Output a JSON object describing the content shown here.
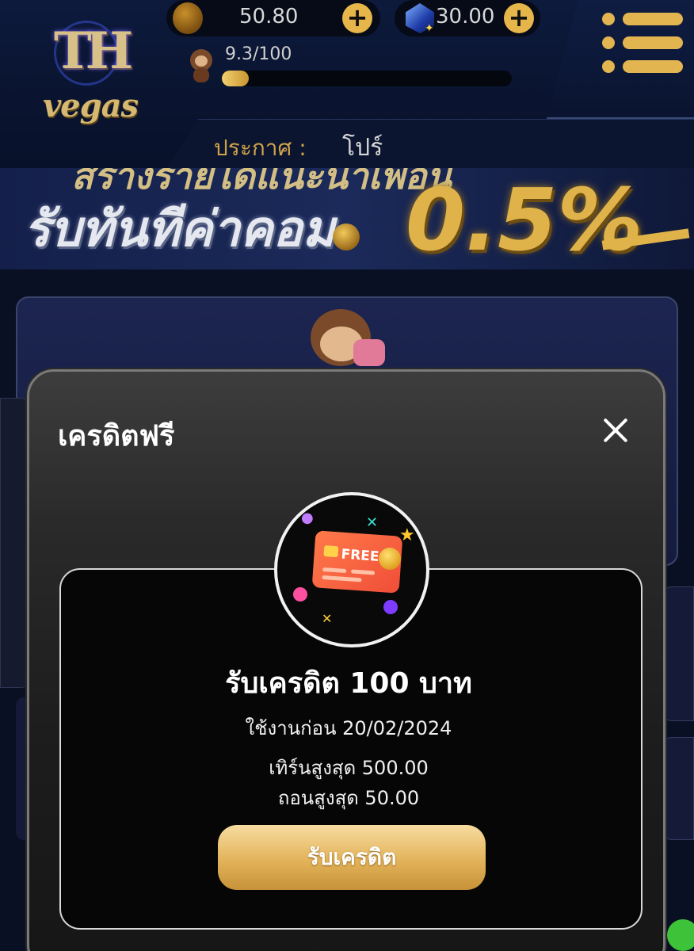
{
  "header": {
    "logo_top": "TH",
    "logo_bottom": "vegas",
    "coin_balance": "50.80",
    "gem_balance": "30.00",
    "plus_label": "+",
    "xp_text": "9.3/100",
    "xp_progress_fraction": 0.093,
    "announce_label": "ประกาศ :",
    "announce_text": "โปร์"
  },
  "banner": {
    "line_main": "รับทันทีค่าคอม",
    "percent": "0.5%"
  },
  "modal": {
    "title": "เครดิตฟรี",
    "card_label": "FREE",
    "reward_title": "รับเครดิต 100 บาท",
    "expire_text": "ใช้งานก่อน 20/02/2024",
    "turnover_text": "เทิร์นสูงสุด 500.00",
    "withdraw_text": "ถอนสูงสุด 50.00",
    "claim_button": "รับเครดิต"
  },
  "colors": {
    "accent_gold": "#e2b550",
    "background": "#0a1024",
    "modal_bg": "#1d1d1d"
  },
  "icons": [
    "coin-icon",
    "gem-icon",
    "plus-icon",
    "menu-icon",
    "close-icon",
    "free-card-icon",
    "monkey-avatar"
  ]
}
